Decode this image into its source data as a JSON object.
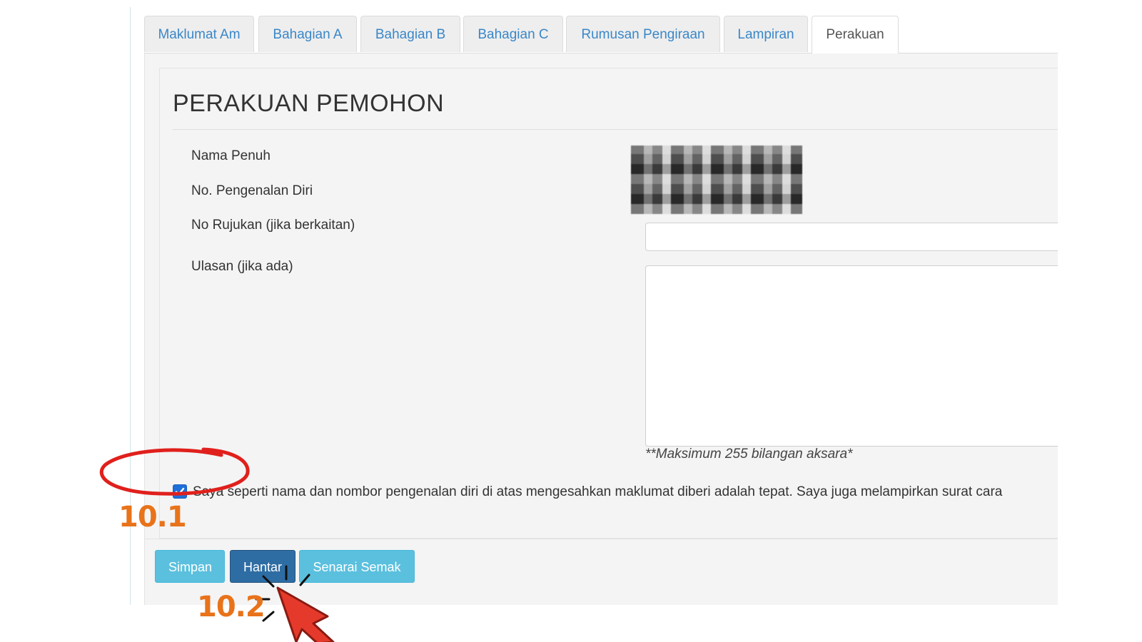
{
  "tabs": [
    {
      "label": "Maklumat Am",
      "active": false
    },
    {
      "label": "Bahagian A",
      "active": false
    },
    {
      "label": "Bahagian B",
      "active": false
    },
    {
      "label": "Bahagian C",
      "active": false
    },
    {
      "label": "Rumusan Pengiraan",
      "active": false
    },
    {
      "label": "Lampiran",
      "active": false
    },
    {
      "label": "Perakuan",
      "active": true
    }
  ],
  "panel": {
    "title": "PERAKUAN PEMOHON",
    "fields": {
      "nama_penuh_label": "Nama Penuh",
      "no_pengenalan_label": "No. Pengenalan Diri",
      "no_rujukan_label": "No Rujukan (jika berkaitan)",
      "no_rujukan_value": "",
      "ulasan_label": "Ulasan (jika ada)",
      "ulasan_value": "",
      "ulasan_hint": "**Maksimum 255 bilangan aksara*"
    },
    "agreement": {
      "checked": true,
      "text": "Saya seperti nama dan nombor pengenalan diri di atas mengesahkan maklumat diberi adalah tepat. Saya juga melampirkan surat cara"
    }
  },
  "buttons": {
    "simpan": "Simpan",
    "hantar": "Hantar",
    "senarai_semak": "Senarai Semak"
  },
  "annotations": {
    "step_1": "10.1",
    "step_2": "10.2",
    "color": "#e8731a",
    "highlight_color": "#e0201c"
  }
}
